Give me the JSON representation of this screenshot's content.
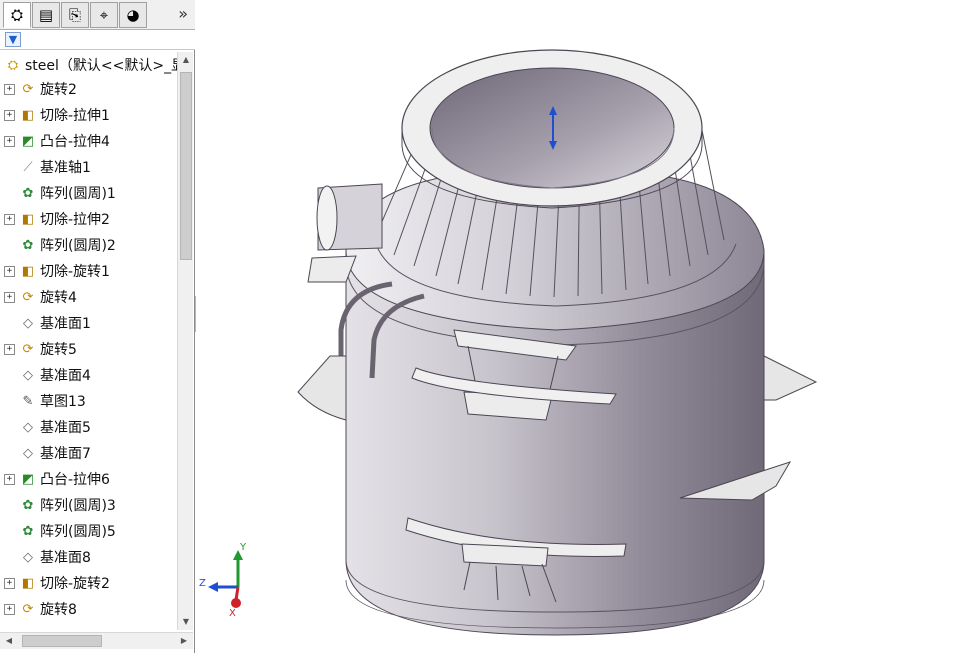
{
  "feature_tree": {
    "tabs": [
      {
        "name": "feature-manager-tab",
        "glyph": "⛭"
      },
      {
        "name": "property-manager-tab",
        "glyph": "▤"
      },
      {
        "name": "configuration-manager-tab",
        "glyph": "⎘"
      },
      {
        "name": "dimxpert-manager-tab",
        "glyph": "⌖"
      },
      {
        "name": "display-manager-tab",
        "glyph": "◕"
      }
    ],
    "more_tabs_glyph": "»",
    "filter_glyph": "▼",
    "root_label": "steel（默认<<默认>_显",
    "items": [
      {
        "label": "旋转2",
        "icon": "revolve",
        "expandable": true
      },
      {
        "label": "切除-拉伸1",
        "icon": "cut",
        "expandable": true
      },
      {
        "label": "凸台-拉伸4",
        "icon": "boss",
        "expandable": true
      },
      {
        "label": "基准轴1",
        "icon": "axis",
        "expandable": false
      },
      {
        "label": "阵列(圆周)1",
        "icon": "pattern",
        "expandable": false
      },
      {
        "label": "切除-拉伸2",
        "icon": "cut",
        "expandable": true
      },
      {
        "label": "阵列(圆周)2",
        "icon": "pattern",
        "expandable": false
      },
      {
        "label": "切除-旋转1",
        "icon": "cut",
        "expandable": true
      },
      {
        "label": "旋转4",
        "icon": "revolve",
        "expandable": true
      },
      {
        "label": "基准面1",
        "icon": "plane",
        "expandable": false
      },
      {
        "label": "旋转5",
        "icon": "revolve",
        "expandable": true
      },
      {
        "label": "基准面4",
        "icon": "plane",
        "expandable": false
      },
      {
        "label": "草图13",
        "icon": "sketch",
        "expandable": false
      },
      {
        "label": "基准面5",
        "icon": "plane",
        "expandable": false
      },
      {
        "label": "基准面7",
        "icon": "plane",
        "expandable": false
      },
      {
        "label": "凸台-拉伸6",
        "icon": "boss",
        "expandable": true
      },
      {
        "label": "阵列(圆周)3",
        "icon": "pattern",
        "expandable": false
      },
      {
        "label": "阵列(圆周)5",
        "icon": "pattern",
        "expandable": false
      },
      {
        "label": "基准面8",
        "icon": "plane",
        "expandable": false
      },
      {
        "label": "切除-旋转2",
        "icon": "cut",
        "expandable": true
      },
      {
        "label": "旋转8",
        "icon": "revolve",
        "expandable": true
      }
    ],
    "icon_glyphs": {
      "part": "⛭",
      "revolve": "⟳",
      "cut": "◧",
      "boss": "◩",
      "axis": "⟋",
      "pattern": "✿",
      "plane": "◇",
      "sketch": "✎"
    }
  },
  "triad": {
    "x_label": "X",
    "y_label": "Y",
    "z_label": "Z"
  },
  "colors": {
    "model_body": "#9c97a4",
    "model_highlight": "#d8d5dc",
    "flange": "#ebebeb",
    "axis_x": "#d0202a",
    "axis_y": "#1f9a2e",
    "axis_z": "#1f4fd0"
  }
}
